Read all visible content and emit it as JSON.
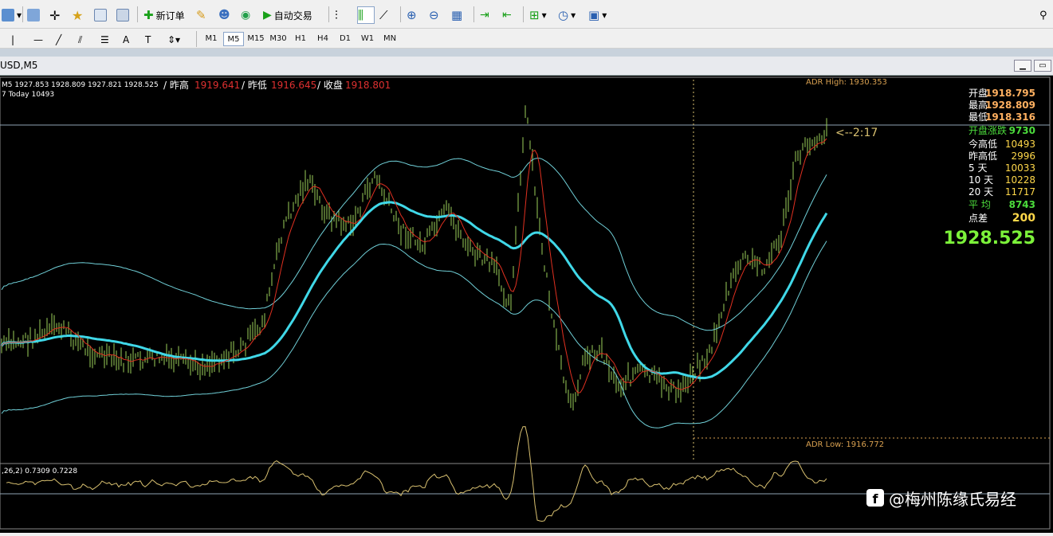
{
  "toolbar": {
    "new_order": "新订单",
    "auto_trade": "自动交易",
    "timeframes": [
      "M1",
      "M5",
      "M15",
      "M30",
      "H1",
      "H4",
      "D1",
      "W1",
      "MN"
    ],
    "active_timeframe": "M5"
  },
  "window": {
    "title": "USD,M5"
  },
  "chart_info": {
    "line1": "M5  1927.853 1928.809 1927.821 1928.525",
    "line2": "7  Today 10493",
    "yh_label": "/ 昨高",
    "yh_value": "1919.641",
    "yl_label": "/ 昨低",
    "yl_value": "1916.645",
    "close_label": "/ 收盘",
    "close_value": "1918.801",
    "adr_high": "ADR High: 1930.353",
    "adr_low": "ADR Low: 1916.772",
    "countdown": "<--2:17",
    "indicator_label": ",26,2) 0.7309 0.7228"
  },
  "stats": [
    {
      "label": "开盘",
      "value": "1918.795",
      "color": "#ffb060"
    },
    {
      "label": "最高",
      "value": "1928.809",
      "color": "#ffb060"
    },
    {
      "label": "最低",
      "value": "1918.316",
      "color": "#ffb060"
    },
    {
      "label": "开盘涨跌",
      "value": "9730",
      "color": "#4cdc3c"
    },
    {
      "label": "今高低",
      "value": "10493",
      "color": "#ffd84a"
    },
    {
      "label": "昨高低",
      "value": "2996",
      "color": "#ffd84a"
    },
    {
      "label": "5   天",
      "value": "10033",
      "color": "#ffd84a"
    },
    {
      "label": "10  天",
      "value": "10228",
      "color": "#ffd84a"
    },
    {
      "label": "20  天",
      "value": "11717",
      "color": "#ffd84a"
    },
    {
      "label": "平   均",
      "value": "8743",
      "color": "#4cdc3c"
    },
    {
      "label": "点差",
      "value": "200",
      "color": "#ffd84a"
    }
  ],
  "current_price": "1928.525",
  "watermark": "@梅州陈缘氏易经",
  "colors": {
    "bull": "#9ccf5a",
    "ma_fast": "#e03020",
    "ma_slow": "#40d8e8",
    "band": "#70d0d8",
    "osc": "#d8c070",
    "price_big": "#7cf23a"
  }
}
